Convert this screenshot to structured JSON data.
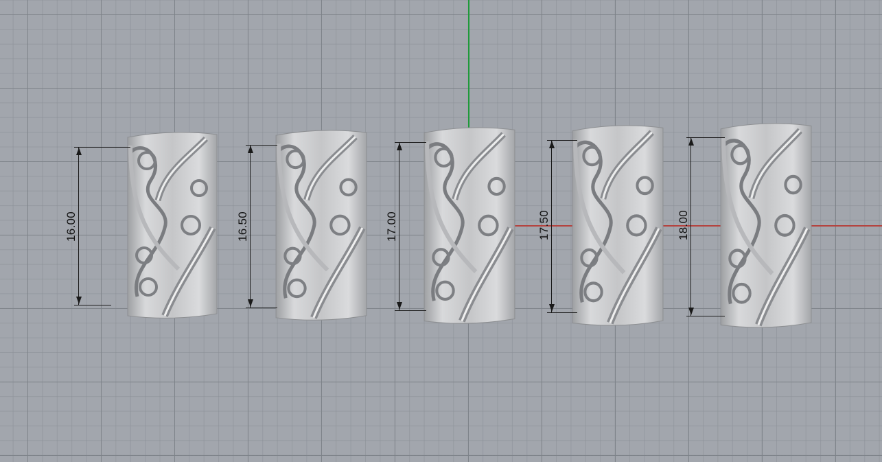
{
  "viewport": {
    "background_color": "#a2a6ad",
    "grid_color": "#7d8289",
    "axis_y_color": "#1f9a3a",
    "axis_x_color": "#b4433f"
  },
  "rings": [
    {
      "label": "16.00"
    },
    {
      "label": "16.50"
    },
    {
      "label": "17.00"
    },
    {
      "label": "17.50"
    },
    {
      "label": "18.00"
    }
  ]
}
